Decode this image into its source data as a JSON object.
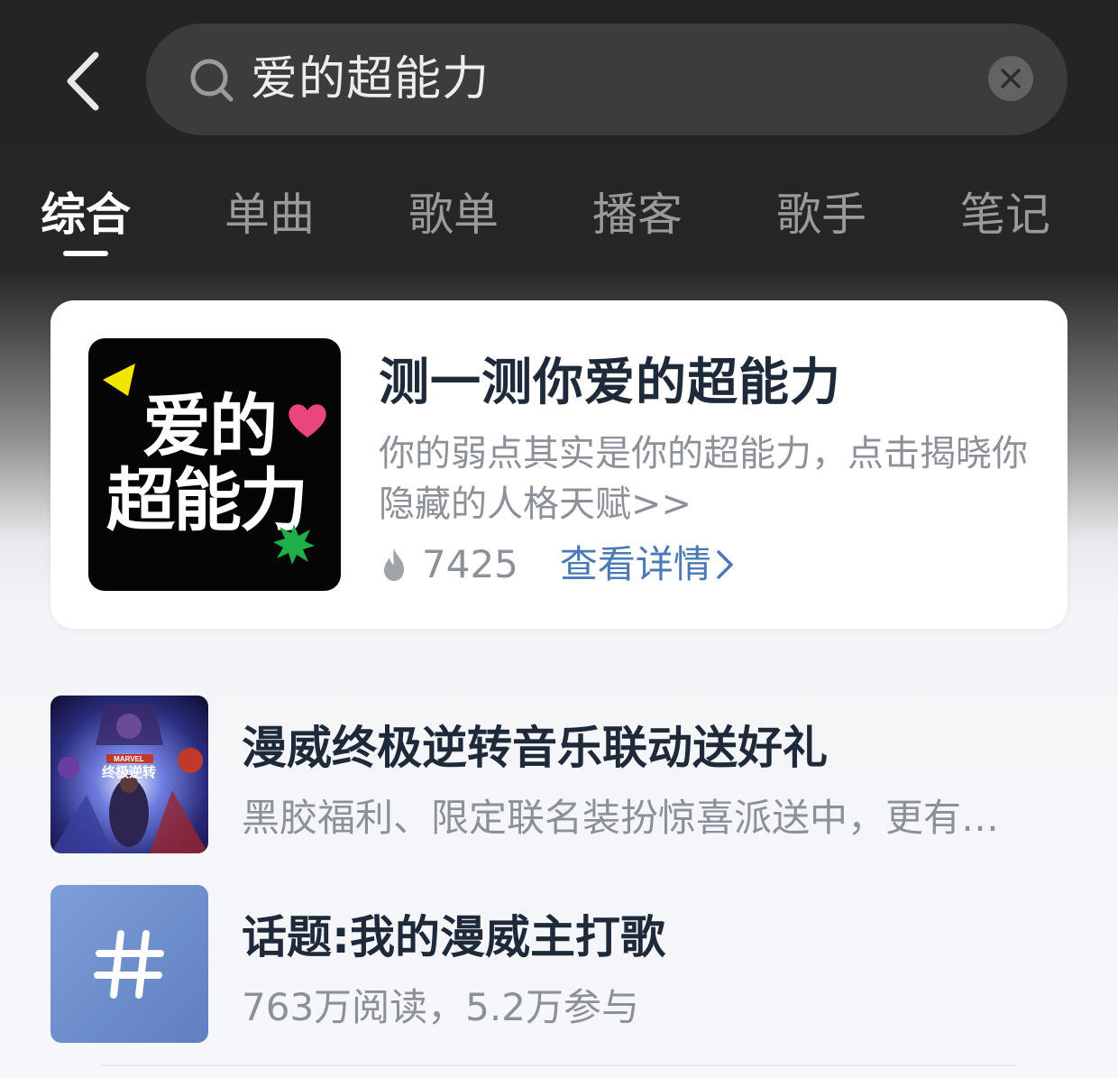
{
  "search": {
    "query": "爱的超能力"
  },
  "tabs": [
    {
      "label": "综合",
      "active": true
    },
    {
      "label": "单曲",
      "active": false
    },
    {
      "label": "歌单",
      "active": false
    },
    {
      "label": "播客",
      "active": false
    },
    {
      "label": "歌手",
      "active": false
    },
    {
      "label": "笔记",
      "active": false
    }
  ],
  "feature_card": {
    "cover_text_line1": "爱的",
    "cover_text_line2": "超能力",
    "title": "测一测你爱的超能力",
    "description": "你的弱点其实是你的超能力，点击揭晓你隐藏的人格天赋>>",
    "hot_count": "7425",
    "detail_link": "查看详情"
  },
  "results": [
    {
      "title": "漫威终极逆转音乐联动送好礼",
      "subtitle": "黑胶福利、限定联名装扮惊喜派送中，更有趣...",
      "thumb_text": "终极逆转",
      "thumb_brand": "MARVEL"
    },
    {
      "title": "话题:我的漫威主打歌",
      "subtitle": "763万阅读，5.2万参与",
      "thumb_symbol": "#"
    }
  ],
  "colors": {
    "accent_link": "#4b79b6",
    "cover_triangle": "#f2e600",
    "cover_heart": "#e9467c",
    "cover_star": "#1fae4a",
    "topic_tile": "#6f8fcd"
  },
  "icons": {
    "back": "chevron-left-icon",
    "search": "search-icon",
    "clear": "close-circle-icon",
    "hot": "fire-icon",
    "detail": "chevron-right-icon"
  }
}
